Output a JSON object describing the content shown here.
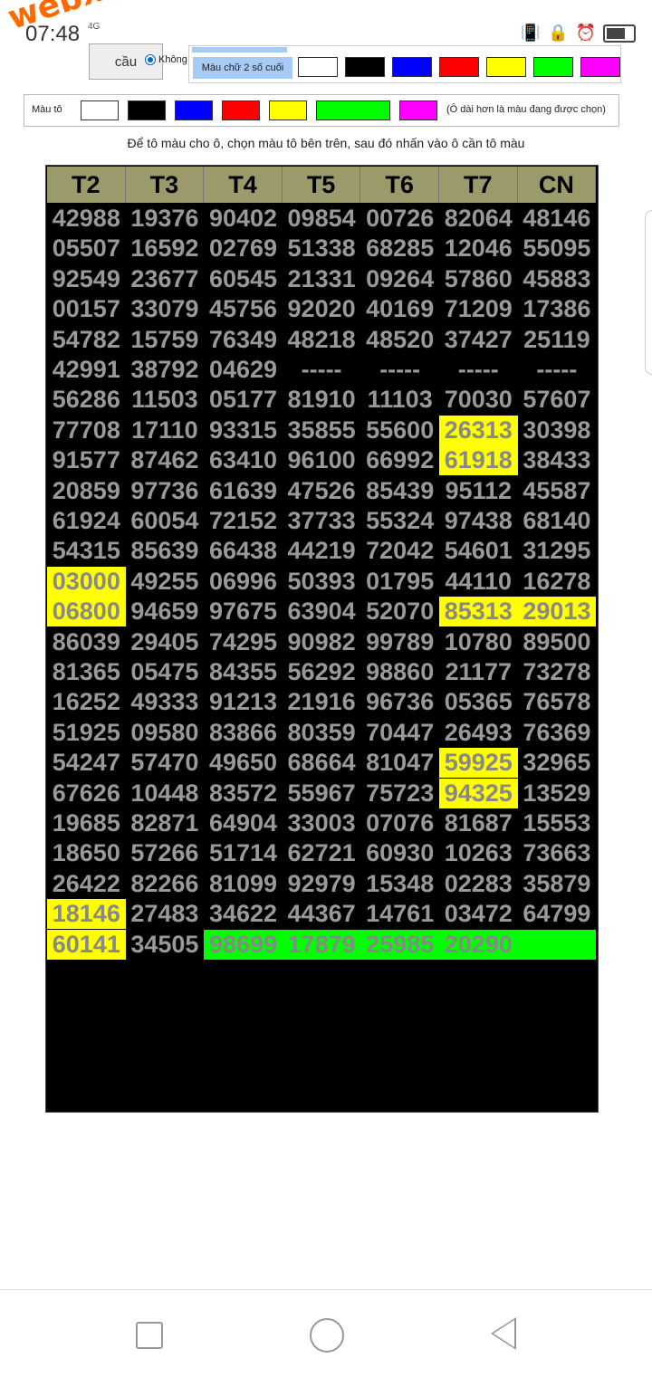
{
  "status_bar": {
    "time": "07:48",
    "network": "4G"
  },
  "watermark": "webxoso.net",
  "controls": {
    "top_button": "cầu",
    "radio_label": "Không",
    "last2_label": "Màu chữ 2 số cuối",
    "fill_label": "Màu tô",
    "fill_note": "(Ô dài hơn là màu đang được chọn)",
    "swatches": [
      "#ffffff",
      "#000000",
      "#0000ff",
      "#ff0000",
      "#ffff00",
      "#00ff00",
      "#ff00ff"
    ],
    "selected_fill": "#00ff00"
  },
  "instruction": "Để tô màu cho ô, chọn màu tô bên trên, sau đó nhấn vào ô cần tô màu",
  "table": {
    "headers": [
      "T2",
      "T3",
      "T4",
      "T5",
      "T6",
      "T7",
      "CN"
    ],
    "rows": [
      [
        "42988",
        "19376",
        "90402",
        "09854",
        "00726",
        "82064",
        "48146"
      ],
      [
        "05507",
        "16592",
        "02769",
        "51338",
        "68285",
        "12046",
        "55095"
      ],
      [
        "92549",
        "23677",
        "60545",
        "21331",
        "09264",
        "57860",
        "45883"
      ],
      [
        "00157",
        "33079",
        "45756",
        "92020",
        "40169",
        "71209",
        "17386"
      ],
      [
        "54782",
        "15759",
        "76349",
        "48218",
        "48520",
        "37427",
        "25119"
      ],
      [
        "42991",
        "38792",
        "04629",
        "-----",
        "-----",
        "-----",
        "-----"
      ],
      [
        "56286",
        "11503",
        "05177",
        "81910",
        "11103",
        "70030",
        "57607"
      ],
      [
        "77708",
        "17110",
        "93315",
        "35855",
        "55600",
        "26313",
        "30398"
      ],
      [
        "91577",
        "87462",
        "63410",
        "96100",
        "66992",
        "61918",
        "38433"
      ],
      [
        "20859",
        "97736",
        "61639",
        "47526",
        "85439",
        "95112",
        "45587"
      ],
      [
        "61924",
        "60054",
        "72152",
        "37733",
        "55324",
        "97438",
        "68140"
      ],
      [
        "54315",
        "85639",
        "66438",
        "44219",
        "72042",
        "54601",
        "31295"
      ],
      [
        "03000",
        "49255",
        "06996",
        "50393",
        "01795",
        "44110",
        "16278"
      ],
      [
        "06800",
        "94659",
        "97675",
        "63904",
        "52070",
        "85313",
        "29013"
      ],
      [
        "86039",
        "29405",
        "74295",
        "90982",
        "99789",
        "10780",
        "89500"
      ],
      [
        "81365",
        "05475",
        "84355",
        "56292",
        "98860",
        "21177",
        "73278"
      ],
      [
        "16252",
        "49333",
        "91213",
        "21916",
        "96736",
        "05365",
        "76578"
      ],
      [
        "51925",
        "09580",
        "83866",
        "80359",
        "70447",
        "26493",
        "76369"
      ],
      [
        "54247",
        "57470",
        "49650",
        "68664",
        "81047",
        "59925",
        "32965"
      ],
      [
        "67626",
        "10448",
        "83572",
        "55967",
        "75723",
        "94325",
        "13529"
      ],
      [
        "19685",
        "82871",
        "64904",
        "33003",
        "07076",
        "81687",
        "15553"
      ],
      [
        "18650",
        "57266",
        "51714",
        "62721",
        "60930",
        "10263",
        "73663"
      ],
      [
        "26422",
        "82266",
        "81099",
        "92979",
        "15348",
        "02283",
        "35879"
      ],
      [
        "18146",
        "27483",
        "34622",
        "44367",
        "14761",
        "03472",
        "64799"
      ],
      [
        "60141",
        "34505",
        "98699",
        "17879",
        "25985",
        "20290",
        ""
      ]
    ],
    "highlights": {
      "7-5": "y",
      "8-5": "y",
      "12-0": "y",
      "13-0": "y",
      "13-5": "y",
      "13-6": "y",
      "18-5": "y",
      "19-5": "y",
      "23-0": "y",
      "24-0": "y",
      "24-2": "g",
      "24-3": "g",
      "24-4": "g",
      "24-5": "g",
      "24-6": "g"
    }
  }
}
